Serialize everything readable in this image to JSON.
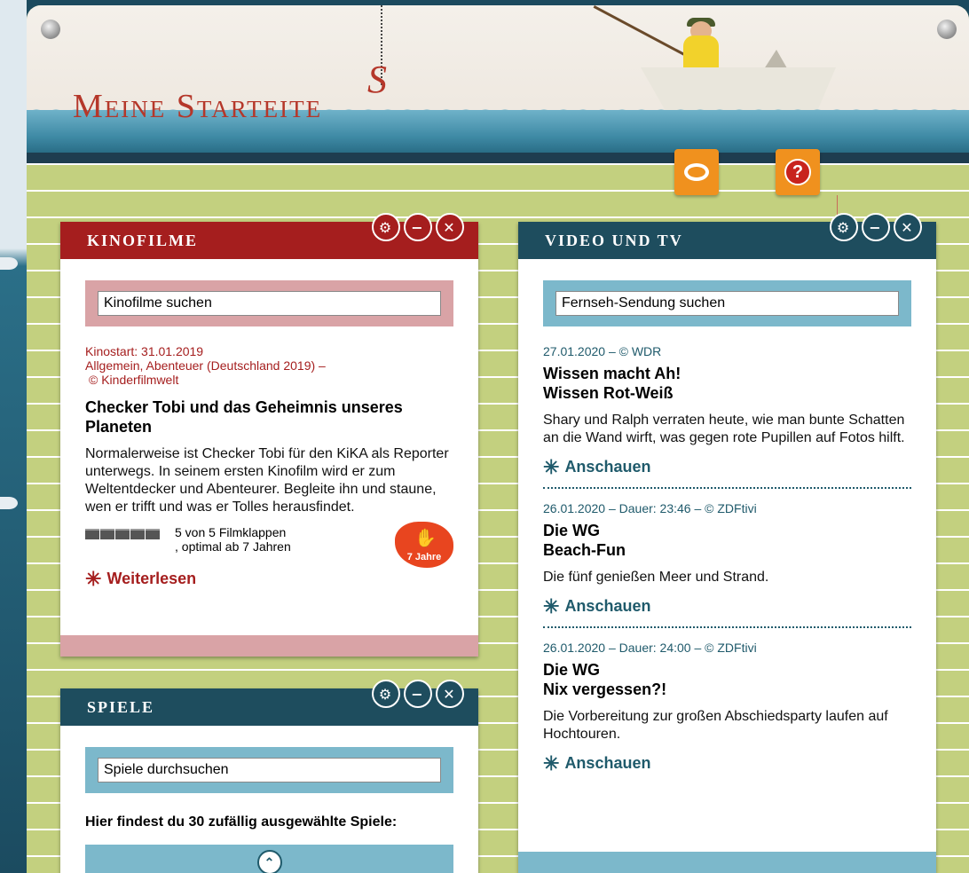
{
  "header": {
    "logo_text": "Meine Start",
    "logo_s": "S",
    "logo_rest": "eite"
  },
  "toolbar": {
    "settings_icon": "palette-icon",
    "help_icon": "question-icon",
    "help_symbol": "?"
  },
  "widget_controls": {
    "settings": "⚙",
    "minimize": "−",
    "close": "✕"
  },
  "kinofilme": {
    "title": "Kinofilme",
    "search_placeholder": "Kinofilme suchen",
    "kinostart": "Kinostart: 31.01.2019",
    "genre": "Allgemein, Abenteuer (Deutschland 2019)  –",
    "copyright": "© Kinderfilmwelt",
    "movie_title": "Checker Tobi und das Geheimnis unseres Planeten",
    "description": "Normalerweise ist Checker Tobi für den KiKA als Reporter unterwegs. In seinem ersten Kinofilm wird er zum Weltentdecker und Abenteurer. Begleite ihn und staune, wen er trifft und was er Tolles herausfindet.",
    "rating_line1": "5 von 5 Filmklappen",
    "rating_line2": ", optimal ab 7 Jahren",
    "rating_value": 5,
    "rating_max": 5,
    "age_badge": "7 Jahre",
    "read_more": "Weiterlesen"
  },
  "spiele": {
    "title": "Spiele",
    "search_placeholder": "Spiele durchsuchen",
    "intro": "Hier findest du 30 zufällig ausgewählte Spiele:"
  },
  "video_tv": {
    "title": "Video und TV",
    "search_placeholder": "Fernseh-Sendung suchen",
    "items": [
      {
        "meta": "27.01.2020 – © WDR",
        "show": "Wissen macht Ah!",
        "episode": "Wissen Rot-Weiß",
        "description": "Shary und Ralph verraten heute, wie man bunte Schatten an die Wand wirft, was gegen rote Pupillen auf Fotos hilft.",
        "action": "Anschauen"
      },
      {
        "meta": "26.01.2020 – Dauer: 23:46 – © ZDFtivi",
        "show": "Die WG",
        "episode": "Beach-Fun",
        "description": "Die fünf genießen Meer und Strand.",
        "action": "Anschauen"
      },
      {
        "meta": "26.01.2020 – Dauer: 24:00 – © ZDFtivi",
        "show": "Die WG",
        "episode": "Nix vergessen?!",
        "description": "Die Vorbereitung zur großen Abschiedsparty laufen auf Hochtouren.",
        "action": "Anschauen"
      }
    ]
  },
  "colors": {
    "kino_accent": "#a51e1e",
    "kino_search_bg": "#d9a3a6",
    "video_accent": "#1e4d5e",
    "video_search_bg": "#7cb8cb",
    "page_bg": "#c3d07f"
  }
}
